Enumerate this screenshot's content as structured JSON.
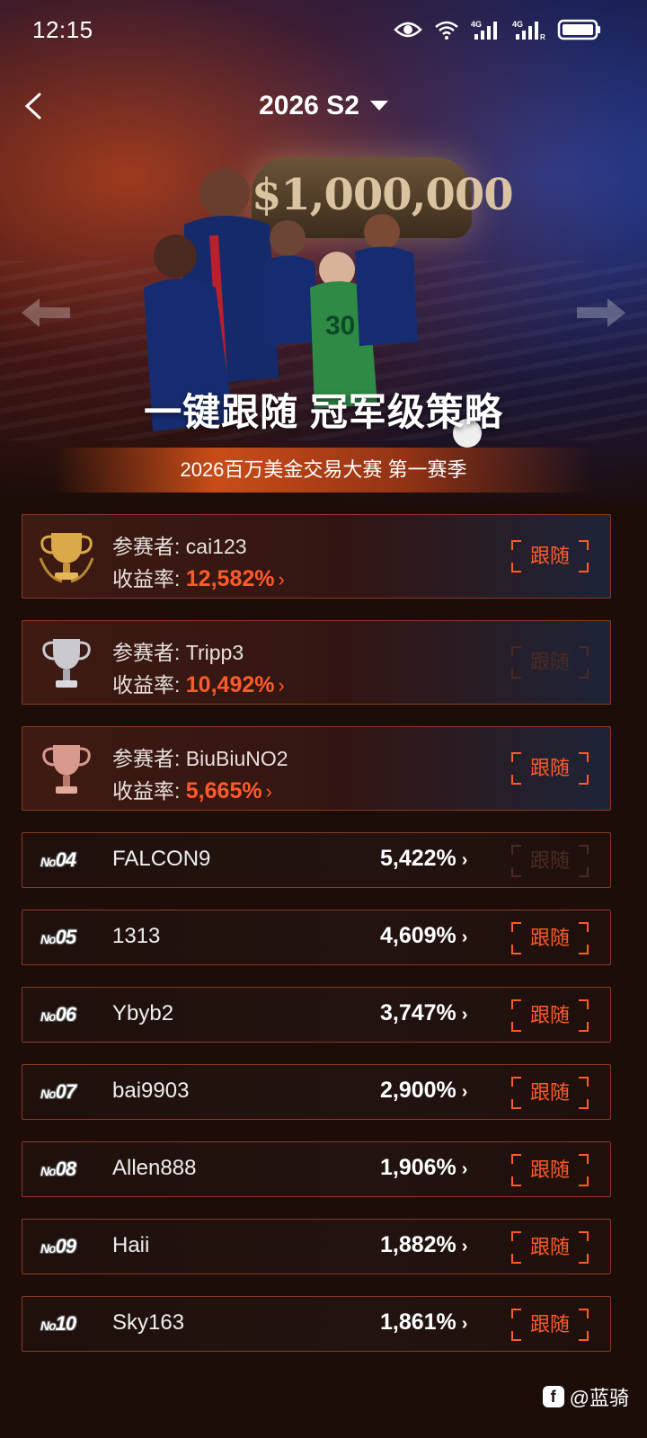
{
  "status": {
    "time": "12:15"
  },
  "header": {
    "season": "2026 S2"
  },
  "banner": {
    "prize_text": "$1,000,000",
    "headline": "一键跟随 冠军级策略",
    "subtitle": "2026百万美金交易大赛 第一赛季"
  },
  "labels": {
    "participant": "参赛者: ",
    "return_rate": "收益率: ",
    "follow": "跟随"
  },
  "top3": [
    {
      "name": "cai123",
      "rate": "12,582%",
      "trophy": "gold",
      "follow_enabled": true
    },
    {
      "name": "Tripp3",
      "rate": "10,492%",
      "trophy": "silver",
      "follow_enabled": false
    },
    {
      "name": "BiuBiuNO2",
      "rate": "5,665%",
      "trophy": "bronze",
      "follow_enabled": true
    }
  ],
  "ranks": [
    {
      "no": "04",
      "name": "FALCON9",
      "rate": "5,422%",
      "follow_enabled": false
    },
    {
      "no": "05",
      "name": "1313",
      "rate": "4,609%",
      "follow_enabled": true
    },
    {
      "no": "06",
      "name": "Ybyb2",
      "rate": "3,747%",
      "follow_enabled": true
    },
    {
      "no": "07",
      "name": "bai9903",
      "rate": "2,900%",
      "follow_enabled": true
    },
    {
      "no": "08",
      "name": "Allen888",
      "rate": "1,906%",
      "follow_enabled": true
    },
    {
      "no": "09",
      "name": "Haii",
      "rate": "1,882%",
      "follow_enabled": true
    },
    {
      "no": "10",
      "name": "Sky163",
      "rate": "1,861%",
      "follow_enabled": true
    }
  ],
  "rank_prefix": "No",
  "watermark": "@蓝骑",
  "colors": {
    "accent": "#ff5b2a",
    "border": "#8a3a22",
    "bg": "#1c0d09"
  }
}
